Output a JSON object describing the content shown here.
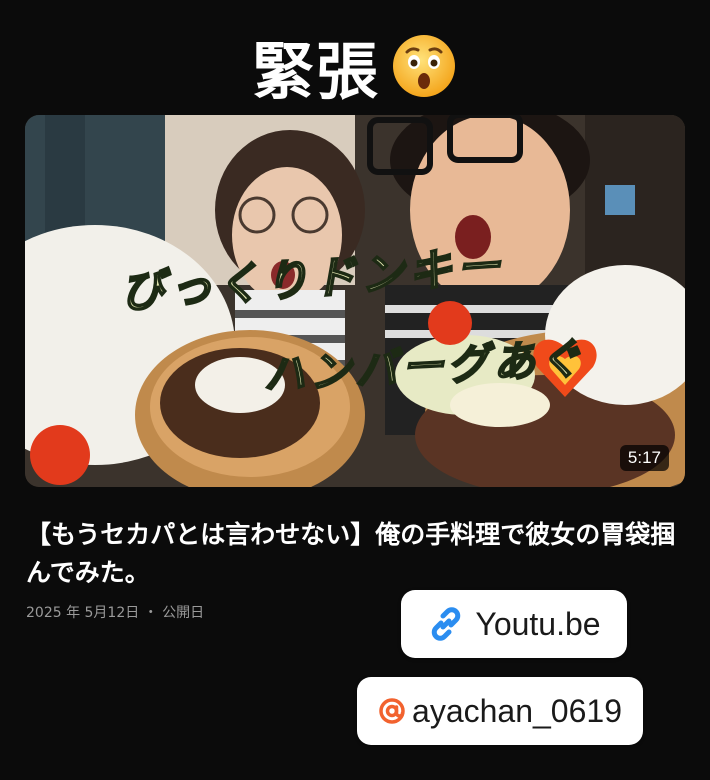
{
  "header": {
    "title": "緊張",
    "emoji": "astonished-face-emoji"
  },
  "video": {
    "overlay_line1": "びっくりドンキー",
    "overlay_line2": "ハンバーグあぐ",
    "duration": "5:17",
    "title": "【もうセカパとは言わせない】俺の手料理で彼女の胃袋掴んでみた。",
    "meta": "2025 年 5月12日 ・ 公開日"
  },
  "stickers": {
    "link_label": "Youtu.be",
    "link_icon": "link-icon",
    "mention_label": "ayachan_0619",
    "mention_icon": "threads-at-icon"
  },
  "colors": {
    "background": "#0b0b0b",
    "link_icon": "#2b8df0",
    "mention_icon": "#f2622e"
  }
}
